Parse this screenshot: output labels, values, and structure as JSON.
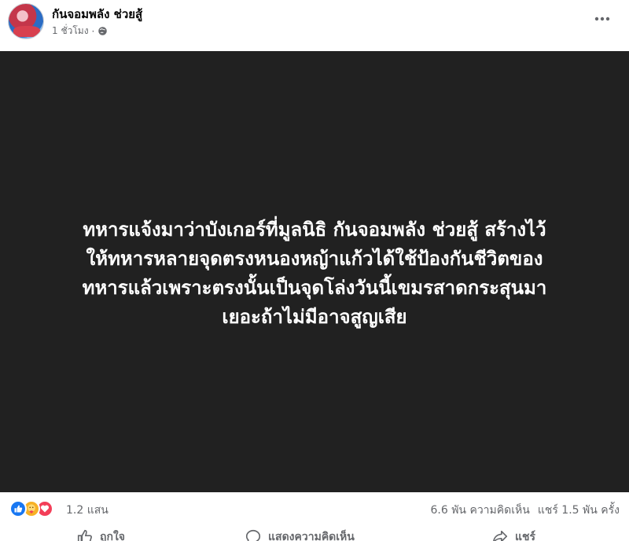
{
  "post": {
    "page_name": "กันจอมพลัง ช่วยสู้",
    "timestamp": "1 ชั่วโมง",
    "separator": "·",
    "image_text": "ทหารแจ้งมาว่าบังเกอร์ที่มูลนิธิ กันจอมพลัง ช่วยสู้ สร้างไว้\nให้ทหารหลายจุดตรงหนองหญ้าแก้วได้ใช้ป้องกันชีวิตของ\nทหารแล้วเพราะตรงนั้นเป็นจุดโล่งวันนี้เขมรสาดกระสุนมา\nเยอะถ้าไม่มีอาจสูญเสีย"
  },
  "stats": {
    "reaction_count": "1.2 แสน",
    "comments": "6.6 พัน ความคิดเห็น",
    "shares": "แชร์ 1.5 พัน ครั้ง"
  },
  "actions": {
    "like": "ถูกใจ",
    "comment": "แสดงความคิดเห็น",
    "share": "แชร์"
  },
  "colors": {
    "image_background": "#212121",
    "like": "#1877f2",
    "care": "#f7b125",
    "love": "#f33e58",
    "muted_text": "#65676b"
  },
  "icons": [
    "globe-icon",
    "more-options-icon",
    "like-reaction-icon",
    "care-reaction-icon",
    "love-reaction-icon",
    "thumbs-up-icon",
    "comment-icon",
    "share-icon"
  ]
}
